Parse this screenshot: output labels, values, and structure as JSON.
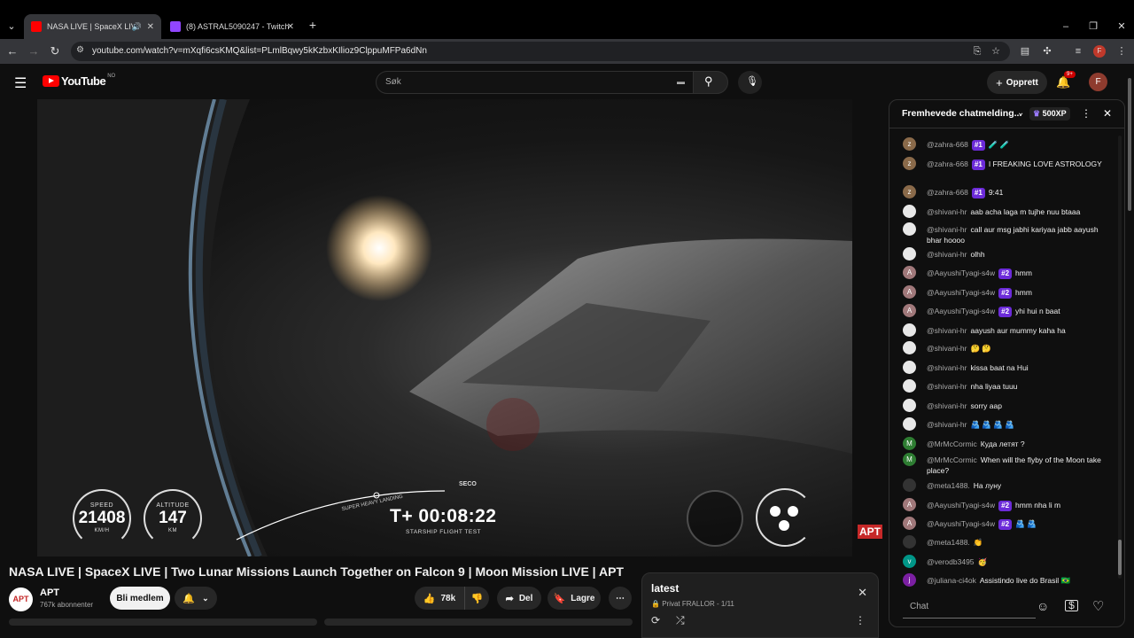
{
  "browser": {
    "tabs": [
      {
        "title": "NASA LIVE | SpaceX LIVE | Tw",
        "active": true
      },
      {
        "title": "(8) ASTRAL5090247 - Twitch",
        "active": false
      }
    ],
    "new_tab": "+",
    "url": "youtube.com/watch?v=mXqfi6csKMQ&list=PLmlBqwy5kKzbxKIlioz9ClppuMFPa6dNn",
    "profile_initial": "F"
  },
  "youtube": {
    "logo_text": "YouTube",
    "region": "NO",
    "search_placeholder": "Søk",
    "create_label": "Opprett",
    "notifications_count": "9+",
    "avatar_initial": "F"
  },
  "video": {
    "hud": {
      "speed_label": "SPEED",
      "speed_value": "21408",
      "speed_unit": "KM/H",
      "altitude_label": "ALTITUDE",
      "altitude_value": "147",
      "altitude_unit": "KM",
      "timer": "T+ 00:08:22",
      "mission": "STARSHIP FLIGHT TEST",
      "event_1": "SUPER HEAVY LANDING",
      "event_2": "SECO"
    },
    "watermark": "APT",
    "title": "NASA LIVE | SpaceX LIVE | Two Lunar Missions Launch Together on Falcon 9 | Moon Mission LIVE | APT"
  },
  "channel": {
    "name": "APT",
    "subscribers": "767k abonnenter",
    "join_label": "Bli medlem"
  },
  "actions": {
    "likes": "78k",
    "share_label": "Del",
    "save_label": "Lagre"
  },
  "playlist": {
    "title": "latest",
    "privacy": "Privat",
    "meta": "FRALLOR - 1/11"
  },
  "chat": {
    "header": "Fremhevede chatmelding...",
    "xp": "500XP",
    "input_placeholder": "Chat",
    "messages": [
      {
        "author": "@zahra-668",
        "badge": "#1",
        "text": "🧪 🧪",
        "avatar": "z",
        "color": "#8a6a4a"
      },
      {
        "author": "@zahra-668",
        "badge": "#1",
        "text": "I FREAKING LOVE ASTROLOGY",
        "avatar": "z",
        "color": "#8a6a4a"
      },
      {
        "author": "@zahra-668",
        "badge": "#1",
        "text": "9:41",
        "avatar": "z",
        "color": "#8a6a4a"
      },
      {
        "author": "@shivani-hr",
        "badge": "",
        "text": "aab acha laga m tujhe nuu btaaa",
        "avatar": "",
        "color": "#e8e8e8"
      },
      {
        "author": "@shivani-hr",
        "badge": "",
        "text": "call aur msg jabhi kariyaa jabb aayush bhar hoooo",
        "avatar": "",
        "color": "#e8e8e8"
      },
      {
        "author": "@shivani-hr",
        "badge": "",
        "text": "olhh",
        "avatar": "",
        "color": "#e8e8e8"
      },
      {
        "author": "@AayushiTyagi-s4w",
        "badge": "#2",
        "text": "hmm",
        "avatar": "A",
        "color": "#a0787a"
      },
      {
        "author": "@AayushiTyagi-s4w",
        "badge": "#2",
        "text": "hmm",
        "avatar": "A",
        "color": "#a0787a"
      },
      {
        "author": "@AayushiTyagi-s4w",
        "badge": "#2",
        "text": "yhi hui n baat",
        "avatar": "A",
        "color": "#a0787a"
      },
      {
        "author": "@shivani-hr",
        "badge": "",
        "text": "aayush aur mummy kaha ha",
        "avatar": "",
        "color": "#e8e8e8"
      },
      {
        "author": "@shivani-hr",
        "badge": "",
        "text": "🤔 🤔",
        "avatar": "",
        "color": "#e8e8e8"
      },
      {
        "author": "@shivani-hr",
        "badge": "",
        "text": "kissa baat na Hui",
        "avatar": "",
        "color": "#e8e8e8"
      },
      {
        "author": "@shivani-hr",
        "badge": "",
        "text": "nha liyaa tuuu",
        "avatar": "",
        "color": "#e8e8e8"
      },
      {
        "author": "@shivani-hr",
        "badge": "",
        "text": "sorry aap",
        "avatar": "",
        "color": "#e8e8e8"
      },
      {
        "author": "@shivani-hr",
        "badge": "",
        "text": "🫂 🫂 🫂 🫂",
        "avatar": "",
        "color": "#e8e8e8"
      },
      {
        "author": "@MrMcCormic",
        "badge": "",
        "text": "Куда летят ?",
        "avatar": "M",
        "color": "#2e7d32"
      },
      {
        "author": "@MrMcCormic",
        "badge": "",
        "text": "When will the flyby of the Moon take place?",
        "avatar": "M",
        "color": "#2e7d32"
      },
      {
        "author": "@meta1488.",
        "badge": "",
        "text": "На луну",
        "avatar": "",
        "color": "#333"
      },
      {
        "author": "@AayushiTyagi-s4w",
        "badge": "#2",
        "text": "hmm nha li m",
        "avatar": "A",
        "color": "#a0787a"
      },
      {
        "author": "@AayushiTyagi-s4w",
        "badge": "#2",
        "text": "🫂 🫂",
        "avatar": "A",
        "color": "#a0787a"
      },
      {
        "author": "@meta1488.",
        "badge": "",
        "text": "👏",
        "avatar": "",
        "color": "#333"
      },
      {
        "author": "@verodb3495",
        "badge": "",
        "text": "🥳",
        "avatar": "v",
        "color": "#009688"
      },
      {
        "author": "@juliana-ci4ok",
        "badge": "",
        "text": "Assistindo live do Brasil 🇧🇷",
        "avatar": "j",
        "color": "#7b1fa2"
      }
    ]
  },
  "colors": {
    "background": "#0f0f0f",
    "accent_red": "#ff0000",
    "badge_purple": "#6c2bd9"
  }
}
